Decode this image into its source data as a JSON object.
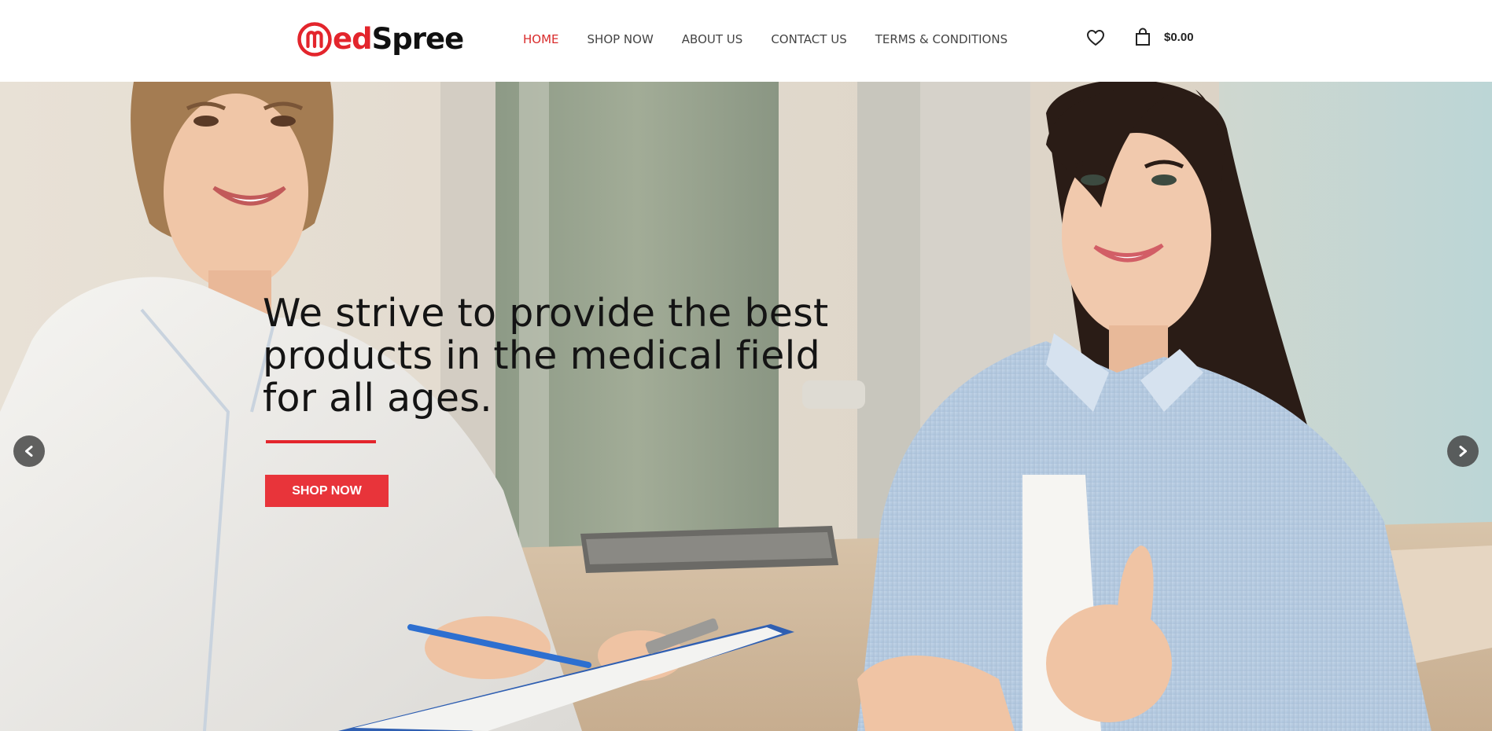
{
  "brand": {
    "logo_initial": "M",
    "logo_text_red": "ed",
    "logo_text_dark": "Spree",
    "primary_color": "#e3252c"
  },
  "nav": {
    "items": [
      {
        "label": "HOME",
        "active": true
      },
      {
        "label": "SHOP NOW",
        "active": false
      },
      {
        "label": "ABOUT US",
        "active": false
      },
      {
        "label": "CONTACT US",
        "active": false
      },
      {
        "label": "TERMS & CONDITIONS",
        "active": false
      }
    ]
  },
  "header_actions": {
    "wishlist_icon": "heart-icon",
    "cart_icon": "shopping-bag-icon",
    "cart_total": "$0.00"
  },
  "hero": {
    "headline": "We strive to provide the best products in the medical field for all ages.",
    "cta_label": "SHOP NOW",
    "prev_icon": "chevron-left-icon",
    "next_icon": "chevron-right-icon"
  }
}
